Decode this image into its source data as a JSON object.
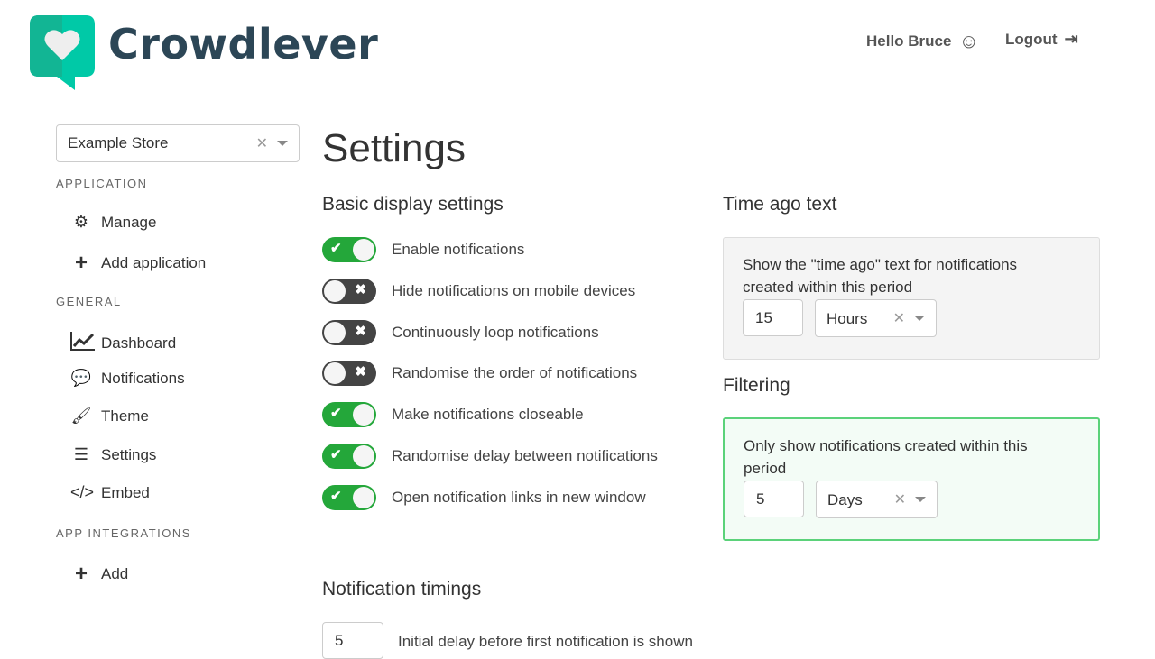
{
  "brand": {
    "name": "Crowdlever",
    "color": "#00c9a7"
  },
  "header": {
    "greeting": "Hello Bruce",
    "logout": "Logout"
  },
  "sidebar": {
    "store_select": "Example Store",
    "sections": [
      {
        "title": "APPLICATION",
        "items": [
          {
            "label": "Manage",
            "icon": "gear-icon"
          },
          {
            "label": "Add application",
            "icon": "plus-icon"
          }
        ]
      },
      {
        "title": "GENERAL",
        "items": [
          {
            "label": "Dashboard",
            "icon": "chart-icon"
          },
          {
            "label": "Notifications",
            "icon": "speech-bubble-icon"
          },
          {
            "label": "Theme",
            "icon": "brush-icon"
          },
          {
            "label": "Settings",
            "icon": "sliders-icon"
          },
          {
            "label": "Embed",
            "icon": "code-icon"
          }
        ]
      },
      {
        "title": "APP INTEGRATIONS",
        "items": [
          {
            "label": "Add",
            "icon": "plus-icon"
          }
        ]
      }
    ]
  },
  "main": {
    "title": "Settings",
    "basic": {
      "heading": "Basic display settings",
      "toggles": [
        {
          "label": "Enable notifications",
          "on": true
        },
        {
          "label": "Hide notifications on mobile devices",
          "on": false
        },
        {
          "label": "Continuously loop notifications",
          "on": false
        },
        {
          "label": "Randomise the order of notifications",
          "on": false
        },
        {
          "label": "Make notifications closeable",
          "on": true
        },
        {
          "label": "Randomise delay between notifications",
          "on": true
        },
        {
          "label": "Open notification links in new window",
          "on": true
        }
      ]
    },
    "time_ago": {
      "heading": "Time ago text",
      "description": "Show the \"time ago\" text for notifications created within this period",
      "value": "15",
      "unit": "Hours"
    },
    "filtering": {
      "heading": "Filtering",
      "description": "Only show notifications created within this period",
      "value": "5",
      "unit": "Days"
    },
    "timings": {
      "heading": "Notification timings",
      "initial_delay": "5",
      "initial_delay_label": "Initial delay before first notification is shown"
    }
  }
}
